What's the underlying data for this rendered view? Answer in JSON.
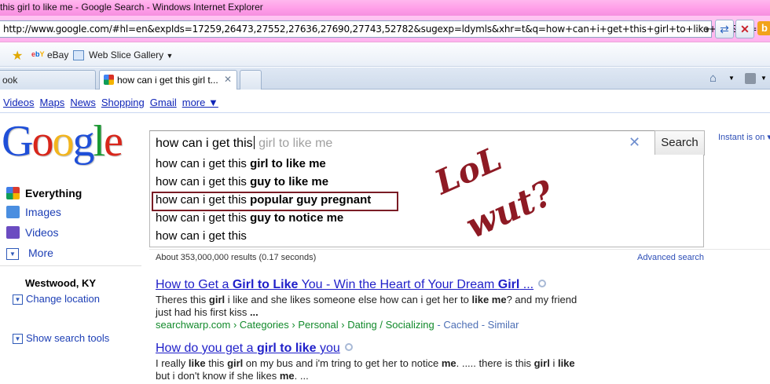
{
  "window": {
    "title": "this girl to like me - Google Search - Windows Internet Explorer"
  },
  "address": {
    "url": "http://www.google.com/#hl=en&expIds=17259,26473,27552,27636,27690,27743,52782&sugexp=ldymls&xhr=t&q=how+can+i+get+this+girl+to+like+me&cp=18&pf="
  },
  "favorites": {
    "ebay_icon": "ebY",
    "ebay_label": "eBay",
    "webslice_label": "Web Slice Gallery"
  },
  "tabs": {
    "inactive_label": "ook",
    "active_label": "how can i get this girl t..."
  },
  "google_nav": {
    "links": [
      "Videos",
      "Maps",
      "News",
      "Shopping",
      "Gmail",
      "more ▼"
    ]
  },
  "logo": {
    "letters": [
      "G",
      "o",
      "o",
      "g",
      "l",
      "e"
    ],
    "colors": [
      "#1f4fd8",
      "#d8261b",
      "#f2b51d",
      "#1f4fd8",
      "#1b9a33",
      "#d8261b"
    ]
  },
  "search": {
    "typed": "how can i get this",
    "ghost": " girl to like me",
    "button_label": "Search",
    "instant_label": "Instant is on ▾"
  },
  "suggestions": [
    {
      "prefix": "how can i get this ",
      "bold": "girl to like me"
    },
    {
      "prefix": "how can i get this ",
      "bold": "guy to like me"
    },
    {
      "prefix": "how can i get this ",
      "bold": "popular guy pregnant"
    },
    {
      "prefix": "how can i get this ",
      "bold": "guy to notice me"
    },
    {
      "prefix": "how can i get this",
      "bold": ""
    }
  ],
  "scrawl": {
    "line1": "LoL",
    "line2": "wut?",
    "color": "#8e1a24"
  },
  "sidebar": {
    "everything": "Everything",
    "images": "Images",
    "videos": "Videos",
    "more": "More",
    "location": "Westwood, KY",
    "change_location": "Change location",
    "show_tools": "Show search tools"
  },
  "results": {
    "stats": "About 353,000,000 results (0.17 seconds)",
    "advanced": "Advanced search",
    "items": [
      {
        "title_parts": [
          "How to Get a ",
          "Girl to Like",
          " You - Win the Heart of Your Dream ",
          "Girl",
          " ..."
        ],
        "snippet_line1": [
          "Theres this ",
          "girl",
          " i like and she likes someone else how can i get her to ",
          "like me",
          "? and my friend"
        ],
        "snippet_line2": [
          "just had his first kiss ",
          "..."
        ],
        "cite": "searchwarp.com › Categories › Personal › Dating / Socializing",
        "cached": " - Cached - Similar"
      },
      {
        "title_parts": [
          "How do you get a ",
          "girl to like",
          " you"
        ],
        "snippet_line1": [
          "I really ",
          "like",
          " this ",
          "girl",
          " on my bus and i'm tring to get her to notice ",
          "me",
          ". ..... there is this ",
          "girl",
          " i ",
          "like"
        ],
        "snippet_line2": [
          "but i don't know if she likes ",
          "me",
          ". ..."
        ]
      }
    ]
  }
}
